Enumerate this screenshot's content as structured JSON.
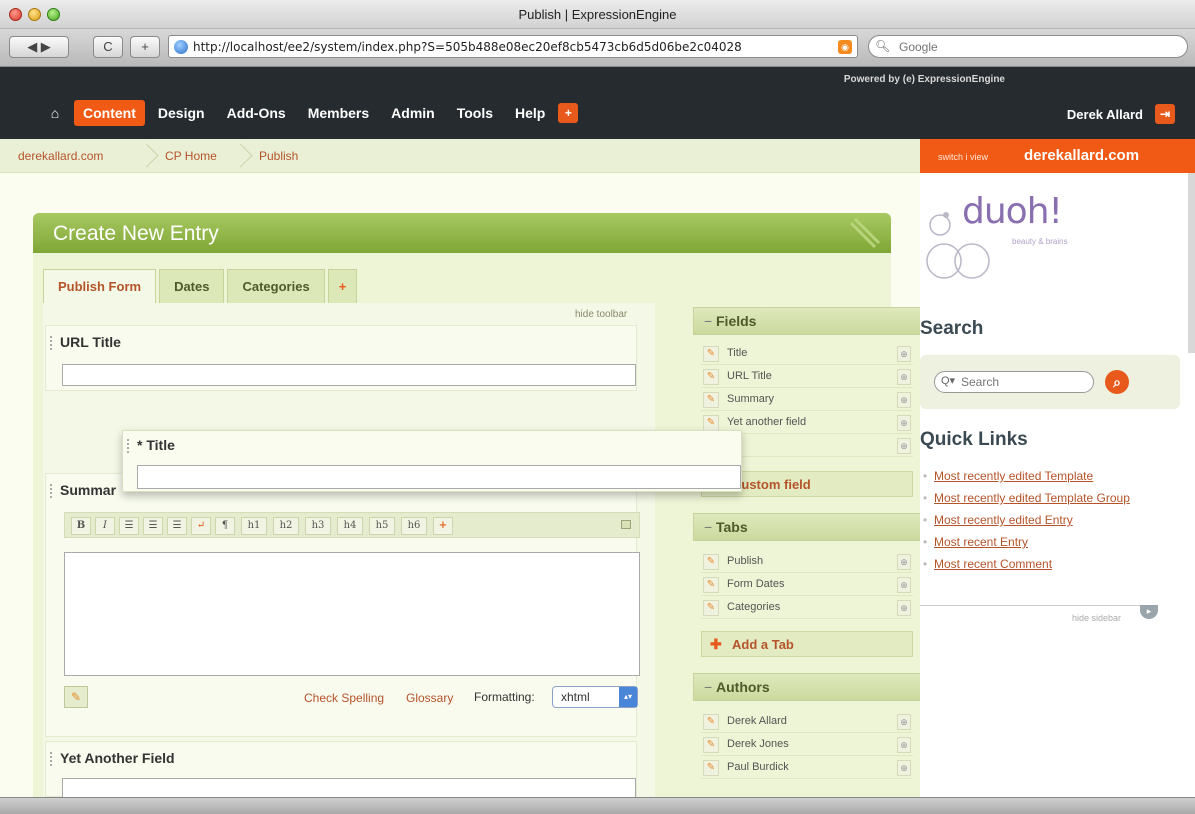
{
  "browser": {
    "window_title": "Publish | ExpressionEngine",
    "url": "http://localhost/ee2/system/index.php?S=505b488e08ec20ef8cb5473cb6d5d06be2c04028",
    "search_placeholder": "Google",
    "nav": {
      "back_forward": "◀ ▶",
      "reload": "C",
      "add": "+"
    }
  },
  "header": {
    "powered_by": "Powered by (e) ExpressionEngine",
    "home_icon": "home-icon",
    "nav": [
      "Content",
      "Design",
      "Add-Ons",
      "Members",
      "Admin",
      "Tools",
      "Help"
    ],
    "active": "Content",
    "plus": "+",
    "user": "Derek Allard"
  },
  "breadcrumbs": [
    "derekallard.com",
    "CP Home",
    "Publish"
  ],
  "switch": {
    "label": "switch i view",
    "site": "derekallard.com"
  },
  "panel": {
    "title": "Create New Entry",
    "tabs": [
      "Publish Form",
      "Dates",
      "Categories"
    ],
    "active_tab": "Publish Form",
    "tab_plus": "+",
    "hide_toolbar": "hide toolbar",
    "fields": {
      "url_title": {
        "label": "URL Title",
        "value": ""
      },
      "title": {
        "label": "* Title",
        "value": ""
      },
      "summary": {
        "label": "Summar"
      },
      "yet_another": {
        "label": "Yet Another Field"
      }
    },
    "wysiwyg_buttons": [
      "B",
      "I",
      "☰",
      "☰",
      "☰",
      "↵",
      "¶",
      "h1",
      "h2",
      "h3",
      "h4",
      "h5",
      "h6",
      "+"
    ],
    "check_spelling": "Check Spelling",
    "glossary": "Glossary",
    "formatting_label": "Formatting:",
    "formatting_value": "xhtml"
  },
  "right_column": {
    "fields": {
      "title": "Fields",
      "items": [
        "Title",
        "URL Title",
        "Summary",
        "Yet another field",
        ""
      ],
      "action": "Custom field"
    },
    "tabs": {
      "title": "Tabs",
      "items": [
        "Publish",
        "Form Dates",
        "Categories"
      ],
      "action": "Add a Tab"
    },
    "authors": {
      "title": "Authors",
      "items": [
        "Derek Allard",
        "Derek Jones",
        "Paul Burdick"
      ]
    }
  },
  "sidebar": {
    "logo_text": "duoh!",
    "logo_tagline": "beauty & brains",
    "search_title": "Search",
    "search_placeholder": "Search",
    "quick_links_title": "Quick Links",
    "quick_links": [
      "Most recently edited Template",
      "Most recently edited Template Group",
      "Most recently edited Entry",
      "Most recent Entry",
      "Most recent Comment"
    ],
    "hide_sidebar": "hide sidebar"
  },
  "colors": {
    "accent": "#f05a14",
    "panel_green": "#8db543",
    "link": "#b5542b",
    "header_dark": "#252b2e"
  }
}
